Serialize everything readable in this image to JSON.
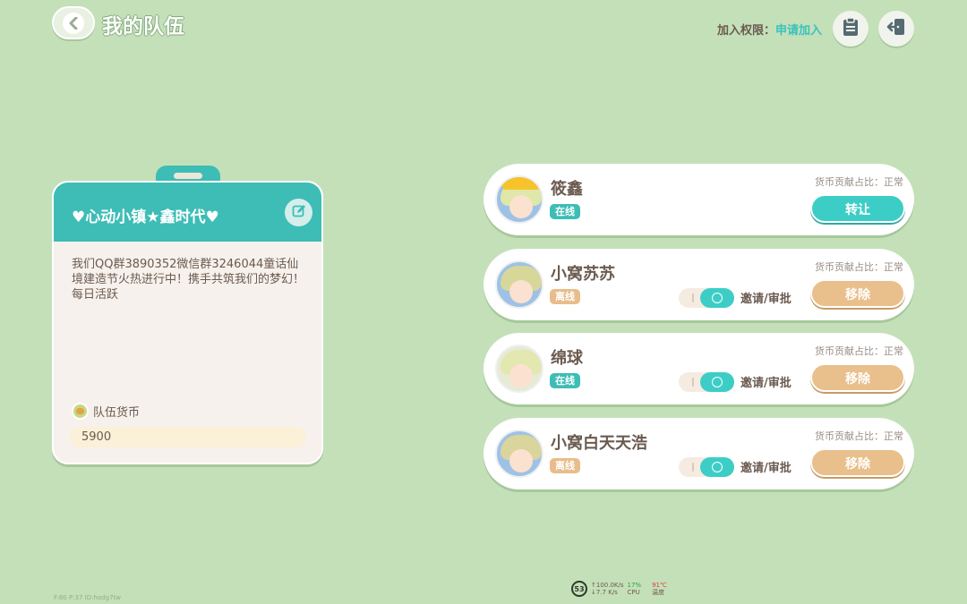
{
  "header": {
    "title": "我的队伍",
    "join_permission_label": "加入权限：",
    "join_permission_value": "申请加入",
    "icons": [
      "back-icon",
      "clipboard-icon",
      "exit-icon"
    ]
  },
  "team": {
    "name": "♥心动小镇★鑫时代♥",
    "description": "我们QQ群3890352微信群3246044童话仙境建造节火热进行中！携手共筑我们的梦幻！每日活跃",
    "currency_label": "队伍货币",
    "currency_value": "5900"
  },
  "members": [
    {
      "name": "筱鑫",
      "status": "在线",
      "contribution": "货币贡献占比：正常",
      "action": "转让"
    },
    {
      "name": "小窝苏苏",
      "status": "离线",
      "contribution": "货币贡献占比：正常",
      "invite_label": "邀请/审批",
      "action": "移除"
    },
    {
      "name": "绵球",
      "status": "在线",
      "contribution": "货币贡献占比：正常",
      "invite_label": "邀请/审批",
      "action": "移除"
    },
    {
      "name": "小窝白天天浩",
      "status": "离线",
      "contribution": "货币贡献占比：正常",
      "invite_label": "邀请/审批",
      "action": "移除"
    }
  ],
  "hud": {
    "fps": "53",
    "net_up": "↑100.0K/s",
    "net_down": "↓7.7",
    "net_unit": "K/s",
    "cpu": "17%",
    "cpu_label": "CPU",
    "temp": "91℃",
    "temp_label": "温度"
  },
  "debug": {
    "text": "F:60   P:37   ID:hadg7tw"
  },
  "colors": {
    "background": "#c4e0b9",
    "teal": "#3dbdb6",
    "orange": "#e9bf8c",
    "card": "#f6f1ec"
  }
}
